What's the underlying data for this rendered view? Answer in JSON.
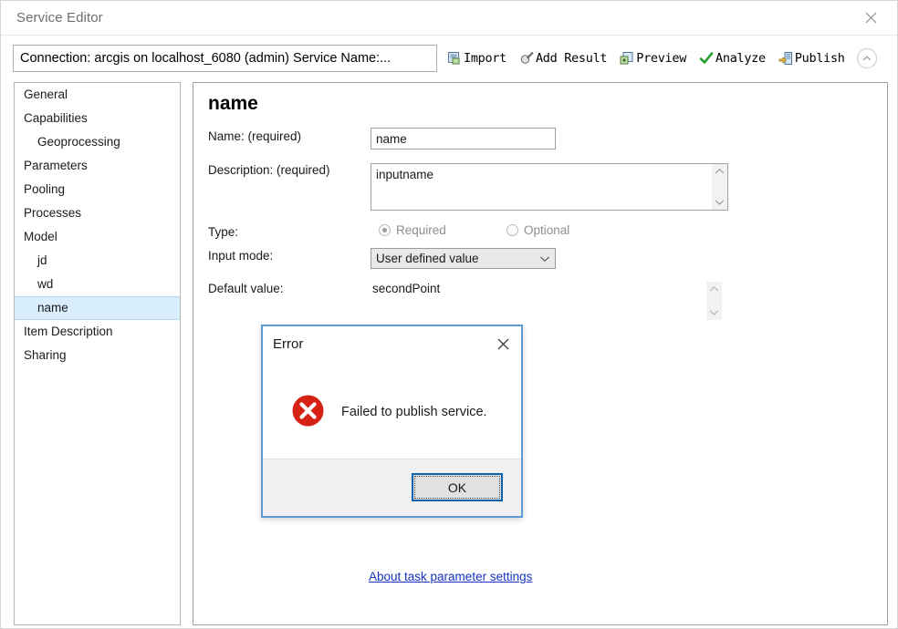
{
  "window": {
    "title": "Service Editor",
    "close_icon": "close-icon"
  },
  "topbar": {
    "connection_text": "Connection: arcgis on localhost_6080 (admin)   Service Name:...",
    "toolbar": [
      {
        "label": "Import",
        "icon": "import-icon"
      },
      {
        "label": "Add Result",
        "icon": "add-result-icon"
      },
      {
        "label": "Preview",
        "icon": "preview-icon"
      },
      {
        "label": "Analyze",
        "icon": "analyze-check-icon"
      },
      {
        "label": "Publish",
        "icon": "publish-icon"
      }
    ],
    "collapse_icon": "chevron-up-icon"
  },
  "sidebar": {
    "items": [
      {
        "label": "General",
        "indent": false,
        "selected": false
      },
      {
        "label": "Capabilities",
        "indent": false,
        "selected": false
      },
      {
        "label": "Geoprocessing",
        "indent": true,
        "selected": false
      },
      {
        "label": "Parameters",
        "indent": false,
        "selected": false
      },
      {
        "label": "Pooling",
        "indent": false,
        "selected": false
      },
      {
        "label": "Processes",
        "indent": false,
        "selected": false
      },
      {
        "label": "Model",
        "indent": false,
        "selected": false
      },
      {
        "label": "jd",
        "indent": true,
        "selected": false
      },
      {
        "label": "wd",
        "indent": true,
        "selected": false
      },
      {
        "label": "name",
        "indent": true,
        "selected": true
      },
      {
        "label": "Item Description",
        "indent": false,
        "selected": false
      },
      {
        "label": "Sharing",
        "indent": false,
        "selected": false
      }
    ]
  },
  "main": {
    "param_title": "name",
    "labels": {
      "name": "Name:  (required)",
      "description": "Description:  (required)",
      "type": "Type:",
      "input_mode": "Input mode:",
      "default_value": "Default value:"
    },
    "name_value": "name",
    "description_value": "inputname",
    "type_options": [
      {
        "label": "Required",
        "checked": true
      },
      {
        "label": "Optional",
        "checked": false
      }
    ],
    "input_mode_value": "User defined value",
    "input_mode_caret": "chevron-down-icon",
    "default_value_text": "secondPoint",
    "about_link": "About task parameter settings"
  },
  "dialog": {
    "title": "Error",
    "close_icon": "close-icon",
    "icon": "error-circle-x-icon",
    "message": "Failed to publish service.",
    "ok_label": "OK"
  },
  "colors": {
    "error_red": "#d62115",
    "focus_blue": "#0a64ad",
    "dialog_border": "#5e9bd1",
    "selection_blue": "#d9eefc",
    "link_blue": "#1433c6"
  }
}
